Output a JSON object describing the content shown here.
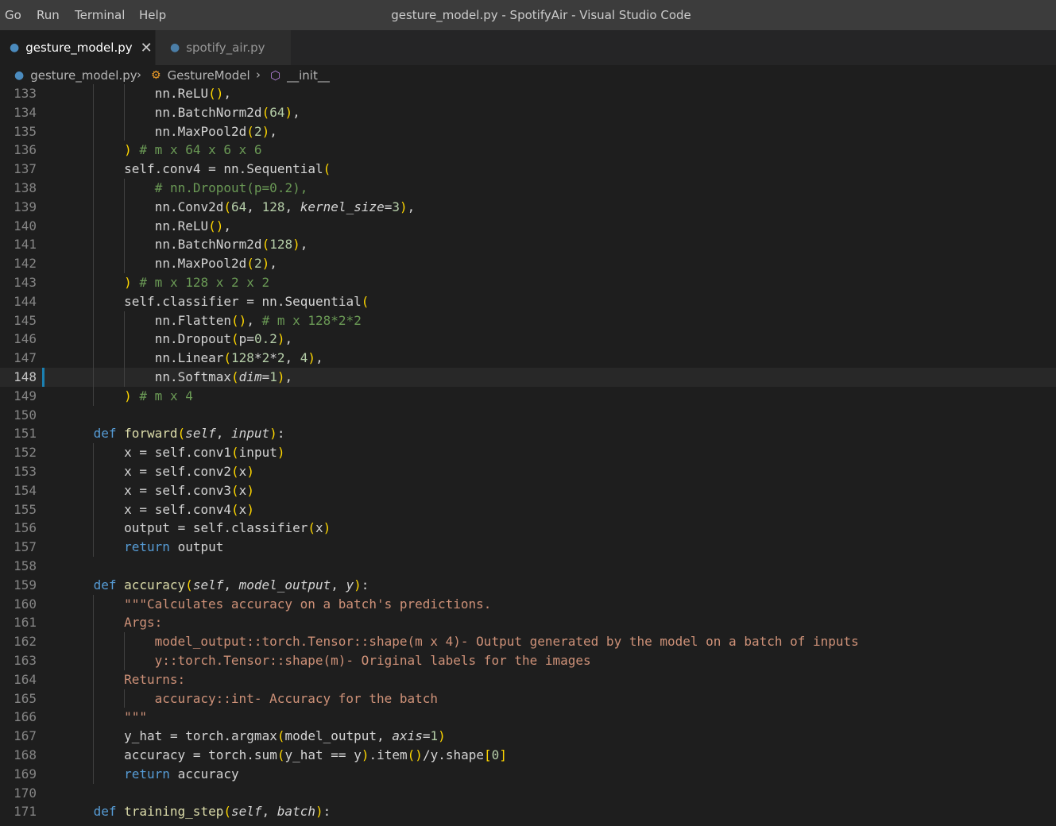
{
  "menu": [
    "Go",
    "Run",
    "Terminal",
    "Help"
  ],
  "window_title": "gesture_model.py - SpotifyAir - Visual Studio Code",
  "tabs": [
    {
      "label": "gesture_model.py",
      "active": true
    },
    {
      "label": "spotify_air.py",
      "active": false
    }
  ],
  "breadcrumb": [
    {
      "label": "gesture_model.py",
      "icon": "python-file-icon"
    },
    {
      "label": "GestureModel",
      "icon": "class-icon"
    },
    {
      "label": "__init__",
      "icon": "method-cube-icon"
    }
  ],
  "colors": {
    "background": "#1e1e1e",
    "keyword": "#569cd6",
    "function": "#dcdcaa",
    "number": "#b5cea8",
    "string": "#ce9178",
    "comment": "#6a9955",
    "variable": "#9cdcfe",
    "current_line_marker": "#1b80b2"
  },
  "editor": {
    "current_line": 148,
    "lines": [
      {
        "n": "133",
        "text": "            nn.ReLU(),"
      },
      {
        "n": "134",
        "text": "            nn.BatchNorm2d(64),"
      },
      {
        "n": "135",
        "text": "            nn.MaxPool2d(2),"
      },
      {
        "n": "136",
        "text": "        ) # m x 64 x 6 x 6"
      },
      {
        "n": "137",
        "text": "        self.conv4 = nn.Sequential("
      },
      {
        "n": "138",
        "text": "            # nn.Dropout(p=0.2),"
      },
      {
        "n": "139",
        "text": "            nn.Conv2d(64, 128, kernel_size=3),"
      },
      {
        "n": "140",
        "text": "            nn.ReLU(),"
      },
      {
        "n": "141",
        "text": "            nn.BatchNorm2d(128),"
      },
      {
        "n": "142",
        "text": "            nn.MaxPool2d(2),"
      },
      {
        "n": "143",
        "text": "        ) # m x 128 x 2 x 2"
      },
      {
        "n": "144",
        "text": "        self.classifier = nn.Sequential("
      },
      {
        "n": "145",
        "text": "            nn.Flatten(), # m x 128*2*2"
      },
      {
        "n": "146",
        "text": "            nn.Dropout(p=0.2),"
      },
      {
        "n": "147",
        "text": "            nn.Linear(128*2*2, 4),"
      },
      {
        "n": "148",
        "text": "            nn.Softmax(dim=1),"
      },
      {
        "n": "149",
        "text": "        ) # m x 4"
      },
      {
        "n": "150",
        "text": ""
      },
      {
        "n": "151",
        "text": "    def forward(self, input):"
      },
      {
        "n": "152",
        "text": "        x = self.conv1(input)"
      },
      {
        "n": "153",
        "text": "        x = self.conv2(x)"
      },
      {
        "n": "154",
        "text": "        x = self.conv3(x)"
      },
      {
        "n": "155",
        "text": "        x = self.conv4(x)"
      },
      {
        "n": "156",
        "text": "        output = self.classifier(x)"
      },
      {
        "n": "157",
        "text": "        return output"
      },
      {
        "n": "158",
        "text": ""
      },
      {
        "n": "159",
        "text": "    def accuracy(self, model_output, y):"
      },
      {
        "n": "160",
        "text": "        \"\"\"Calculates accuracy on a batch's predictions."
      },
      {
        "n": "161",
        "text": "        Args:"
      },
      {
        "n": "162",
        "text": "            model_output::torch.Tensor::shape(m x 4)- Output generated by the model on a batch of inputs"
      },
      {
        "n": "163",
        "text": "            y::torch.Tensor::shape(m)- Original labels for the images"
      },
      {
        "n": "164",
        "text": "        Returns:"
      },
      {
        "n": "165",
        "text": "            accuracy::int- Accuracy for the batch"
      },
      {
        "n": "166",
        "text": "        \"\"\""
      },
      {
        "n": "167",
        "text": "        y_hat = torch.argmax(model_output, axis=1)"
      },
      {
        "n": "168",
        "text": "        accuracy = torch.sum(y_hat == y).item()/y.shape[0]"
      },
      {
        "n": "169",
        "text": "        return accuracy"
      },
      {
        "n": "170",
        "text": ""
      },
      {
        "n": "171",
        "text": "    def training_step(self, batch):"
      }
    ]
  }
}
